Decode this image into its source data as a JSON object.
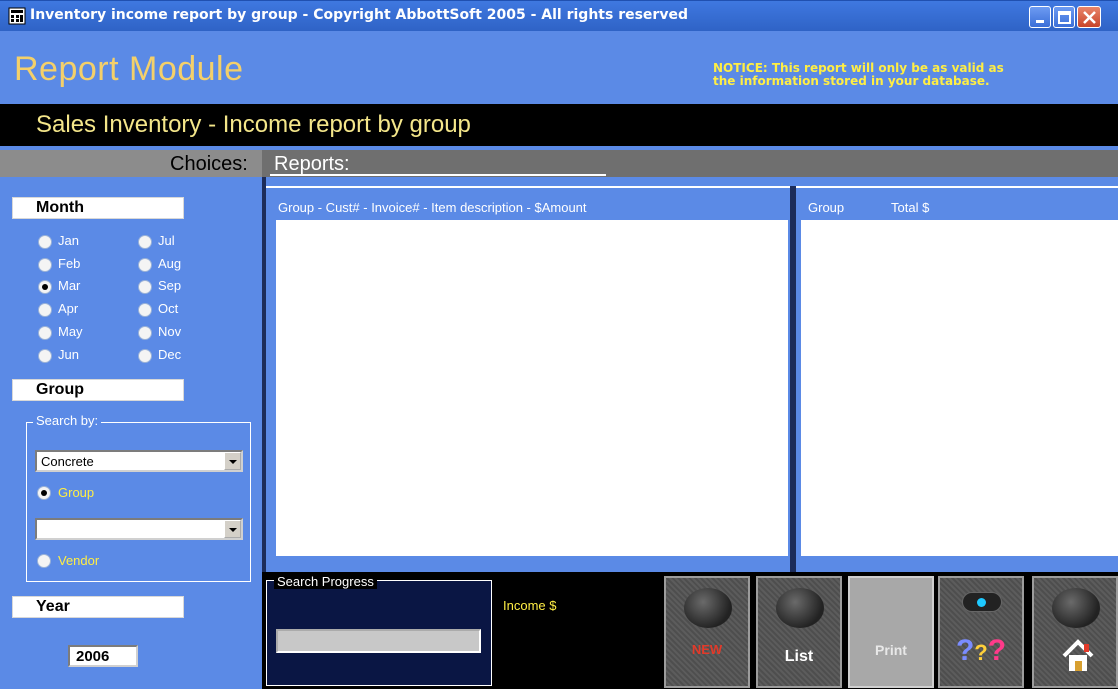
{
  "window": {
    "title": "Inventory income report by group   -   Copyright AbbottSoft 2005   -   All rights reserved",
    "icon": "app-icon",
    "controls": [
      "minimize-icon",
      "maximize-icon",
      "close-icon"
    ]
  },
  "header": {
    "module_title": "Report Module",
    "notice_line1": "NOTICE:  This report will only be as valid as",
    "notice_line2": "the information stored in your database.",
    "report_title": "Sales Inventory - Income report by group"
  },
  "sections": {
    "choices": "Choices:",
    "reports": "Reports:"
  },
  "month": {
    "label": "Month",
    "selected": "Mar",
    "left": [
      "Jan",
      "Feb",
      "Mar",
      "Apr",
      "May",
      "Jun"
    ],
    "right": [
      "Jul",
      "Aug",
      "Sep",
      "Oct",
      "Nov",
      "Dec"
    ]
  },
  "group": {
    "label": "Group",
    "search_by": "Search by:",
    "group_combo_value": "Concrete",
    "vendor_combo_value": "",
    "option_group": "Group",
    "option_vendor": "Vendor",
    "selected_option": "Group"
  },
  "year": {
    "label": "Year",
    "value": "2006"
  },
  "reports": {
    "detail_header": "Group - Cust# - Invoice# - Item description - $Amount",
    "summary_header_group": "Group",
    "summary_header_total": "Total $"
  },
  "bottom": {
    "search_progress": "Search Progress",
    "search_progress_value": 0,
    "income_label": "Income $",
    "buttons": {
      "new": "NEW",
      "list": "List",
      "print": "Print",
      "help": "??",
      "home": "home-icon"
    }
  },
  "colors": {
    "panel_blue": "#5b8ae6",
    "title_gold": "#f4d06a",
    "notice_yellow": "#ffee44",
    "new_red": "#e23a2a"
  }
}
